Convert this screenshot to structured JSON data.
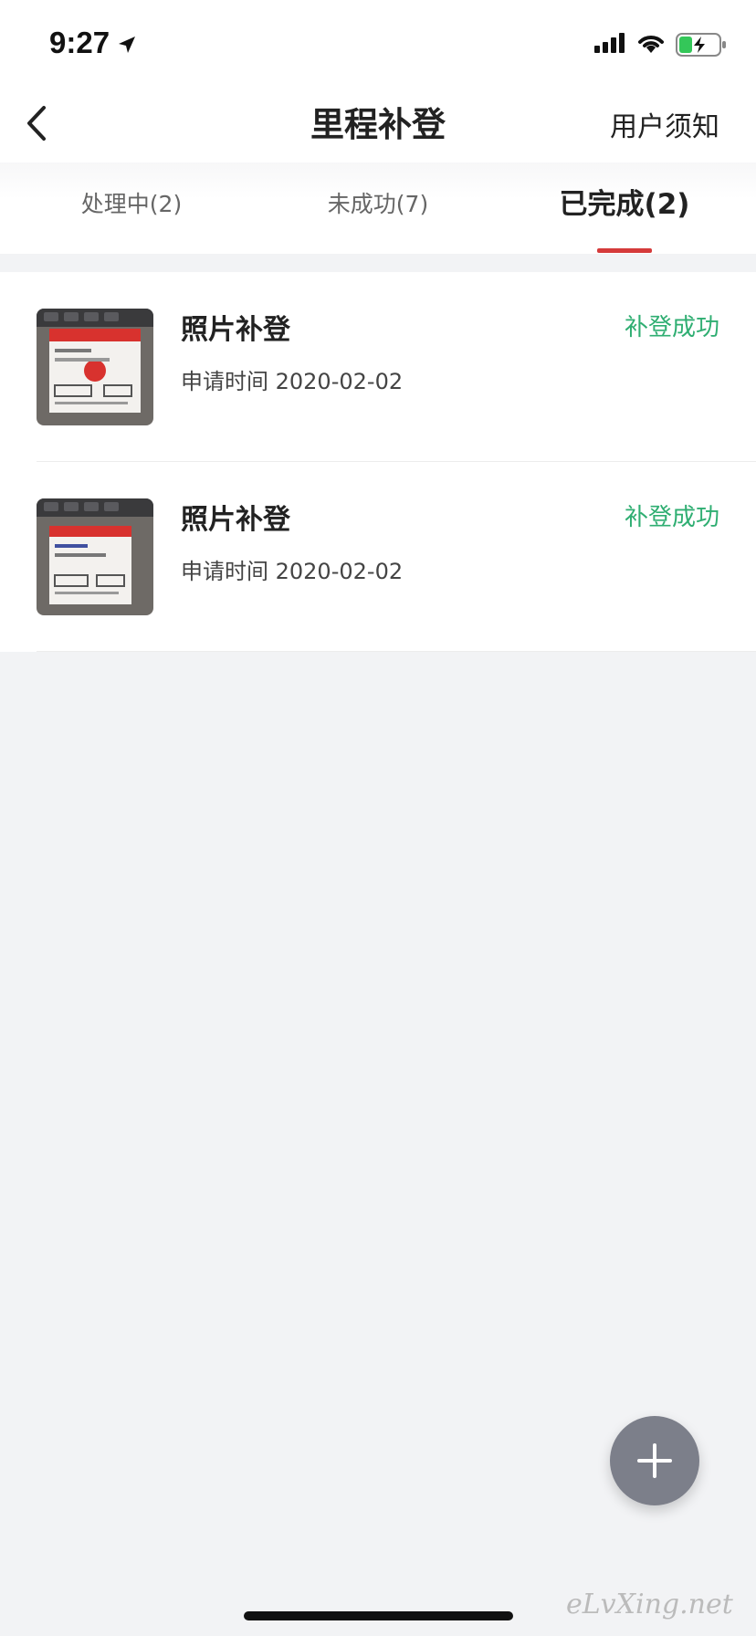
{
  "status_bar": {
    "time": "9:27"
  },
  "nav": {
    "title": "里程补登",
    "notice": "用户须知"
  },
  "tabs": [
    {
      "label": "处理中(2)",
      "active": false
    },
    {
      "label": "未成功(7)",
      "active": false
    },
    {
      "label": "已完成(2)",
      "active": true
    }
  ],
  "items": [
    {
      "title": "照片补登",
      "date": "申请时间 2020-02-02",
      "status": "补登成功",
      "thumb_icon": "boarding-pass-photo"
    },
    {
      "title": "照片补登",
      "date": "申请时间 2020-02-02",
      "status": "补登成功",
      "thumb_icon": "boarding-pass-photo"
    }
  ],
  "watermark": "eLvXing.net",
  "colors": {
    "accent_red": "#d53a3a",
    "success_green": "#2fae72",
    "fab_gray": "#7c7f8a",
    "background": "#f2f3f5"
  }
}
